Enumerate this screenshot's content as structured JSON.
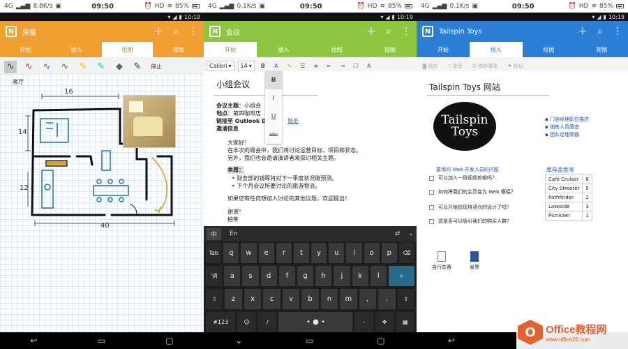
{
  "status": {
    "network": "4G",
    "speed_1": "8.8K/s",
    "speed_2": "0.1K/s",
    "speed_3": "0.1K/s",
    "time": "09:50",
    "hd": "HD",
    "battery": "85%",
    "inner_time": "10:19"
  },
  "phone1": {
    "app_title": "房屋",
    "tabs": [
      "开始",
      "插入",
      "绘图",
      "视图"
    ],
    "selected_tab": "绘图",
    "pen_tools": [
      "lasso-icon",
      "pen-red-icon",
      "pen-teal-icon",
      "pen-green-icon",
      "highlighter-yellow-icon",
      "highlighter-cyan-icon",
      "eraser-icon"
    ],
    "stop_label": "停止",
    "room_label": "客厅",
    "dims": {
      "top": "16",
      "left": "14",
      "left2": "12",
      "bottom": "40"
    }
  },
  "phone2": {
    "app_title": "会议",
    "tabs": [
      "开始",
      "插入",
      "绘图",
      "视图"
    ],
    "selected_tab": "开始",
    "font": "Calibri",
    "size": "14",
    "format_menu": [
      "B",
      "I",
      "U",
      "abc"
    ],
    "note_title": "小组会议",
    "meta": {
      "topic_label": "会议主题",
      "topic_value": "：小组会",
      "place_label": "地点",
      "place_value": "：第四咖啡店",
      "link_label": "链接至 Outlook D",
      "link_text": "批处",
      "invite_label": "邀请信息"
    },
    "body": {
      "greeting": "大家好！",
      "line1": "在本次的周会中，我们将讨论运营目标、项目和状态。",
      "line2": "另外，我们也会邀请演讲者来探讨相关主题。",
      "week": "本周：",
      "bullet1": "财务部的钱晖将对下一季度状况做预测。",
      "bullet2": "下个月会议所要讨论的旅游物流。",
      "closing": "如果您有任何想加入讨论的其他议题，欢迎提出！",
      "thanks": "谢谢！",
      "sign": "柏隼"
    },
    "keyboard": {
      "lang_zh": "中",
      "lang_en": "En",
      "row1": [
        "q",
        "w",
        "e",
        "r",
        "t",
        "y",
        "u",
        "i",
        "o",
        "p"
      ],
      "row2": [
        "a",
        "s",
        "d",
        "f",
        "g",
        "h",
        "j",
        "k",
        "l"
      ],
      "row3": [
        "z",
        "x",
        "c",
        "v",
        "b",
        "n",
        "m"
      ],
      "tab": "Tab",
      "ci": "'词",
      "num": "#123"
    }
  },
  "phone3": {
    "app_title": "Tailspin Toys",
    "tabs": [
      "开始",
      "插入",
      "绘图",
      "视图"
    ],
    "selected_tab": "插入",
    "insert_items": [
      "图片",
      "录音",
      "待办事项",
      "标记"
    ],
    "note_title": "Tailspin Toys 网站",
    "logo_line1": "Tailspin",
    "logo_line2": "Toys",
    "links": [
      "门店经理职位描述",
      "销售人员康宜",
      "团队经理摩霸"
    ],
    "questions_head": "要询问 Web 开发人员的问题",
    "questions": [
      "可以加入一段视频剪辑吗？",
      "如何将我们的主页变为 Web 横幅？",
      "可以开始较现持清仓的设计了吗？",
      "这是否可以吸引我们的购买人群？"
    ],
    "inventory_head": "库存品型号",
    "inventory": [
      {
        "name": "Café Cruiser",
        "qty": "8"
      },
      {
        "name": "City Streeter",
        "qty": "5"
      },
      {
        "name": "Pathfinder",
        "qty": "2"
      },
      {
        "name": "Lakeside",
        "qty": "3"
      },
      {
        "name": "Picnicker",
        "qty": "1"
      }
    ],
    "attachments": [
      "自行车赛",
      "发票"
    ]
  },
  "watermark": {
    "title": "Office教程网",
    "url": "www.office26.com"
  },
  "colors": {
    "phone1_accent": "#f0a030",
    "phone2_accent": "#8ec63f",
    "phone3_accent": "#2c7fd6"
  }
}
